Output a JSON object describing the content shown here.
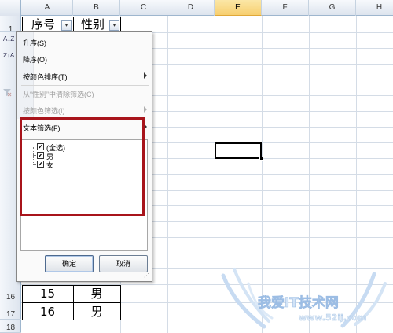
{
  "columns": [
    "A",
    "B",
    "C",
    "D",
    "E",
    "F",
    "G",
    "H"
  ],
  "selected_column": "E",
  "row_numbers": {
    "top": [
      "1"
    ],
    "bottom": [
      "16",
      "17",
      "18"
    ]
  },
  "header_cells": {
    "a1": "序号",
    "b1": "性别"
  },
  "data_rows": [
    {
      "a": "15",
      "b": "男"
    },
    {
      "a": "16",
      "b": "男"
    }
  ],
  "filter_button_glyph": "▾",
  "menu": {
    "sort_asc": "升序(S)",
    "sort_desc": "降序(O)",
    "sort_by_color": "按颜色排序(T)",
    "clear_filter": "从“性别”中清除筛选(C)",
    "filter_by_color": "按颜色筛选(I)",
    "text_filter": "文本筛选(F)",
    "sort_asc_icon": "A↓Z",
    "sort_desc_icon": "Z↓A",
    "list": {
      "select_all": "(全选)",
      "items": [
        "男",
        "女"
      ],
      "check_glyph": "✔"
    },
    "ok_button": "确定",
    "cancel_button": "取消",
    "grip_glyph": "⋰"
  },
  "watermark": {
    "text": "我爱IT技术网",
    "url": "www.52ij.com"
  },
  "colors": {
    "highlight_frame": "#a8141b",
    "header_bg": "#dde4ee",
    "selected_column_bg": "#f7cf70"
  }
}
